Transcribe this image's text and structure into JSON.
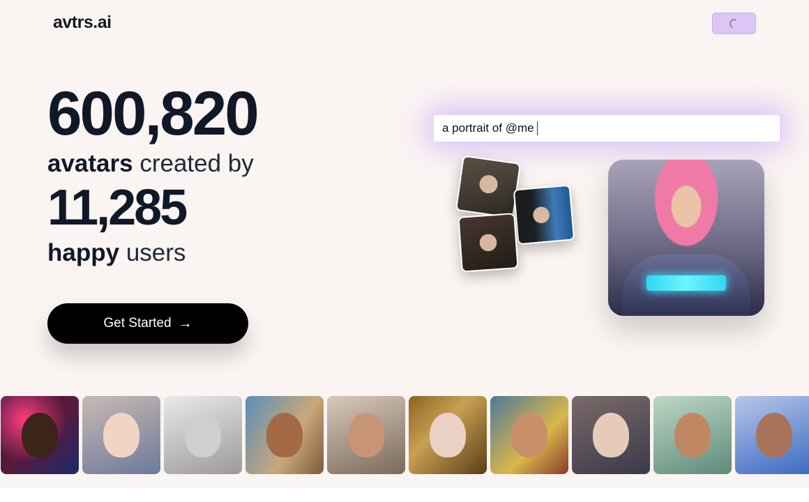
{
  "header": {
    "logo": "avtrs.ai",
    "loading_button": {
      "state": "loading",
      "icon": "spinner-icon"
    }
  },
  "hero": {
    "avatars_count": "600,820",
    "line1_bold": "avatars",
    "line1_rest": "created by",
    "users_count": "11,285",
    "line2_bold": "happy",
    "line2_rest": "users",
    "cta_label": "Get Started",
    "cta_icon": "arrow-right-icon"
  },
  "prompt": {
    "value": "a portrait of @me"
  },
  "selfies": [
    "selfie-photo",
    "selfie-photo",
    "selfie-photo"
  ],
  "result": {
    "icon": "avatar-result-image"
  },
  "gallery": {
    "tiles": [
      "avatar-1",
      "avatar-2",
      "avatar-3",
      "avatar-4",
      "avatar-5",
      "avatar-6",
      "avatar-7",
      "avatar-8",
      "avatar-9",
      "avatar-10"
    ]
  },
  "colors": {
    "background": "#faf4f2",
    "text": "#111827",
    "accent_glow": "#ad78ff",
    "button_loading": "#dcc6f6",
    "cta_bg": "#000000"
  }
}
